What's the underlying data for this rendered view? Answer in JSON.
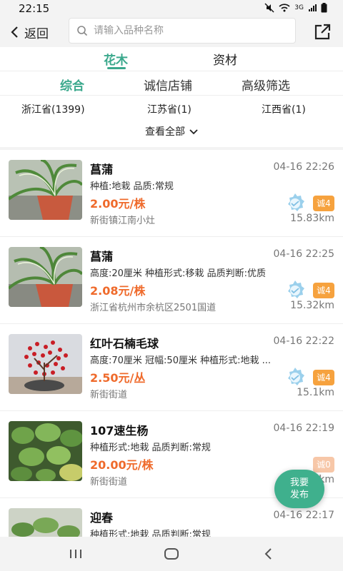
{
  "status": {
    "time": "22:15",
    "network": "3G"
  },
  "header": {
    "back_label": "返回",
    "search_placeholder": "请输入品种名称"
  },
  "category_tabs": [
    {
      "label": "花木",
      "active": true
    },
    {
      "label": "资材",
      "active": false
    }
  ],
  "sort_tabs": [
    {
      "label": "综合",
      "active": true
    },
    {
      "label": "诚信店铺",
      "active": false
    },
    {
      "label": "高级筛选",
      "active": false
    }
  ],
  "provinces": [
    "浙江省(1399)",
    "江苏省(1)",
    "江西省(1)"
  ],
  "view_all_label": "查看全部",
  "items": [
    {
      "title": "菖蒲",
      "time": "04-16 22:26",
      "attrs": "种植:地栽    品质:常规",
      "price": "2.00元/株",
      "location": "新街镇江南小灶",
      "distance": "15.83km",
      "badge": "诚4",
      "verified": true,
      "image": "plant-pot-icon"
    },
    {
      "title": "菖蒲",
      "time": "04-16 22:25",
      "attrs": "高度:20厘米    种植形式:移栽    品质判断:优质",
      "price": "2.08元/株",
      "location": "浙江省杭州市余杭区2501国道",
      "distance": "15.32km",
      "badge": "诚4",
      "verified": true,
      "image": "plant-pot-icon"
    },
    {
      "title": "红叶石楠毛球",
      "time": "04-16 22:22",
      "attrs": "高度:70厘米    冠幅:50厘米    种植形式:地栽  ...",
      "price": "2.50元/丛",
      "location": "新街街道",
      "distance": "15.1km",
      "badge": "诚4",
      "verified": true,
      "image": "red-shrub-icon"
    },
    {
      "title": "107速生杨",
      "time": "04-16 22:19",
      "attrs": "种植形式:地栽    品质判断:常规",
      "price": "20.00元/株",
      "location": "新街街道",
      "distance": "15.1km",
      "badge": "诚0",
      "verified": false,
      "image": "leaves-icon"
    },
    {
      "title": "迎春",
      "time": "04-16 22:17",
      "attrs": "种植形式:地栽    品质判断:常规",
      "price": "",
      "location": "",
      "distance": "",
      "badge": "",
      "verified": false,
      "image": "leaves-icon"
    }
  ],
  "fab": {
    "line1": "我要",
    "line2": "发布"
  },
  "colors": {
    "accent": "#3aa88c",
    "price": "#ef6a2b",
    "badge": "#f6a23e",
    "fab": "#3fb08d"
  }
}
